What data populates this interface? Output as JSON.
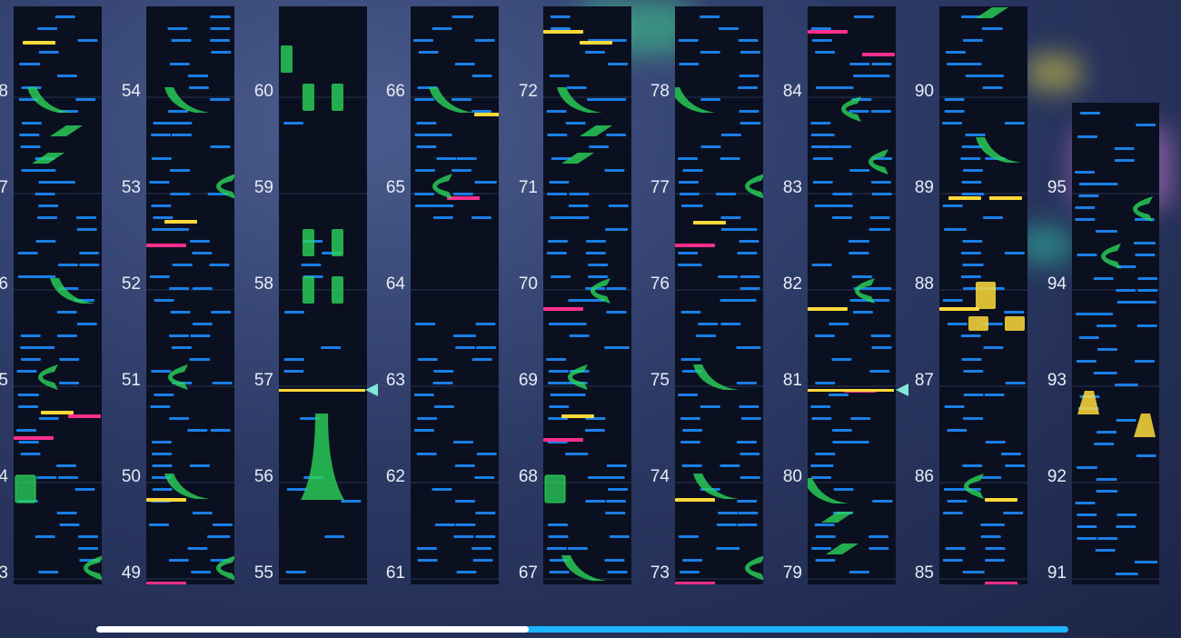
{
  "colors": {
    "blue_note": "#1a7fe6",
    "green_note": "#2bd45a",
    "yellow_note": "#ffd93a",
    "pink_note": "#ff2f8e",
    "progress_track": "#1ab4ff",
    "progress_fill": "#ffffff"
  },
  "measures": {
    "col0": [
      "3",
      "4",
      "5",
      "6",
      "7",
      "8"
    ],
    "col1": [
      "49",
      "50",
      "51",
      "52",
      "53",
      "54"
    ],
    "col2": [
      "55",
      "56",
      "57",
      "58",
      "59",
      "60"
    ],
    "col3": [
      "61",
      "62",
      "63",
      "64",
      "65",
      "66"
    ],
    "col4": [
      "67",
      "68",
      "69",
      "70",
      "71",
      "72"
    ],
    "col5": [
      "73",
      "74",
      "75",
      "76",
      "77",
      "78"
    ],
    "col6": [
      "79",
      "80",
      "81",
      "82",
      "83",
      "84"
    ],
    "col7": [
      "85",
      "86",
      "87",
      "88",
      "89",
      "90"
    ],
    "col8": [
      "91",
      "92",
      "93",
      "94",
      "95"
    ]
  },
  "progress": {
    "fraction": 0.445
  },
  "icons": {
    "playhead": "playhead-marker-icon"
  }
}
